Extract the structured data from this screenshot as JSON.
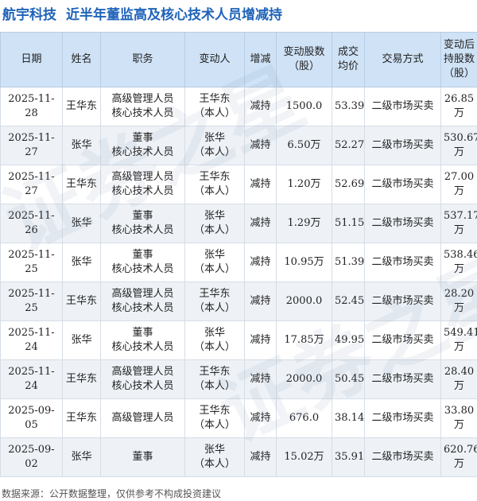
{
  "header": {
    "company": "航宇科技",
    "title": "近半年董监高及核心技术人员增减持"
  },
  "watermark": "证券之星",
  "columns": {
    "date": "日期",
    "name": "姓名",
    "position": "职务",
    "changer": "变动人",
    "direction": "增减",
    "change_line1": "变动股数",
    "change_line2": "（股）",
    "price_line1": "成交",
    "price_line2": "均价",
    "method": "交易方式",
    "after_line1": "变动后",
    "after_line2": "持股数",
    "after_line3": "（股）"
  },
  "rows": [
    {
      "date": "2025-11-28",
      "name": "王华东",
      "pos1": "高级管理人员",
      "pos2": "核心技术人员",
      "ch1": "王华东",
      "ch2": "（本人）",
      "dir": "减持",
      "shares": "1500.0",
      "price": "53.39",
      "method": "二级市场买卖",
      "after": "26.85万"
    },
    {
      "date": "2025-11-27",
      "name": "张华",
      "pos1": "董事",
      "pos2": "核心技术人员",
      "ch1": "张华",
      "ch2": "（本人）",
      "dir": "减持",
      "shares": "6.50万",
      "price": "52.27",
      "method": "二级市场买卖",
      "after": "530.67万"
    },
    {
      "date": "2025-11-27",
      "name": "王华东",
      "pos1": "高级管理人员",
      "pos2": "核心技术人员",
      "ch1": "王华东",
      "ch2": "（本人）",
      "dir": "减持",
      "shares": "1.20万",
      "price": "52.69",
      "method": "二级市场买卖",
      "after": "27.00万"
    },
    {
      "date": "2025-11-26",
      "name": "张华",
      "pos1": "董事",
      "pos2": "核心技术人员",
      "ch1": "张华",
      "ch2": "（本人）",
      "dir": "减持",
      "shares": "1.29万",
      "price": "51.15",
      "method": "二级市场买卖",
      "after": "537.17万"
    },
    {
      "date": "2025-11-25",
      "name": "张华",
      "pos1": "董事",
      "pos2": "核心技术人员",
      "ch1": "张华",
      "ch2": "（本人）",
      "dir": "减持",
      "shares": "10.95万",
      "price": "51.39",
      "method": "二级市场买卖",
      "after": "538.46万"
    },
    {
      "date": "2025-11-25",
      "name": "王华东",
      "pos1": "高级管理人员",
      "pos2": "核心技术人员",
      "ch1": "王华东",
      "ch2": "（本人）",
      "dir": "减持",
      "shares": "2000.0",
      "price": "52.45",
      "method": "二级市场买卖",
      "after": "28.20万"
    },
    {
      "date": "2025-11-24",
      "name": "张华",
      "pos1": "董事",
      "pos2": "核心技术人员",
      "ch1": "张华",
      "ch2": "（本人）",
      "dir": "减持",
      "shares": "17.85万",
      "price": "49.95",
      "method": "二级市场买卖",
      "after": "549.41万"
    },
    {
      "date": "2025-11-24",
      "name": "王华东",
      "pos1": "高级管理人员",
      "pos2": "核心技术人员",
      "ch1": "王华东",
      "ch2": "（本人）",
      "dir": "减持",
      "shares": "2000.0",
      "price": "50.45",
      "method": "二级市场买卖",
      "after": "28.40万"
    },
    {
      "date": "2025-09-05",
      "name": "王华东",
      "pos1": "高级管理人员",
      "pos2": "",
      "ch1": "王华东",
      "ch2": "（本人）",
      "dir": "减持",
      "shares": "676.0",
      "price": "38.14",
      "method": "二级市场买卖",
      "after": "33.80万"
    },
    {
      "date": "2025-09-02",
      "name": "张华",
      "pos1": "董事",
      "pos2": "",
      "ch1": "张华",
      "ch2": "（本人）",
      "dir": "减持",
      "shares": "15.02万",
      "price": "35.91",
      "method": "二级市场买卖",
      "after": "620.76万"
    }
  ],
  "footer": {
    "source": "数据来源：公开数据整理，仅供参考不构成投资建议"
  }
}
